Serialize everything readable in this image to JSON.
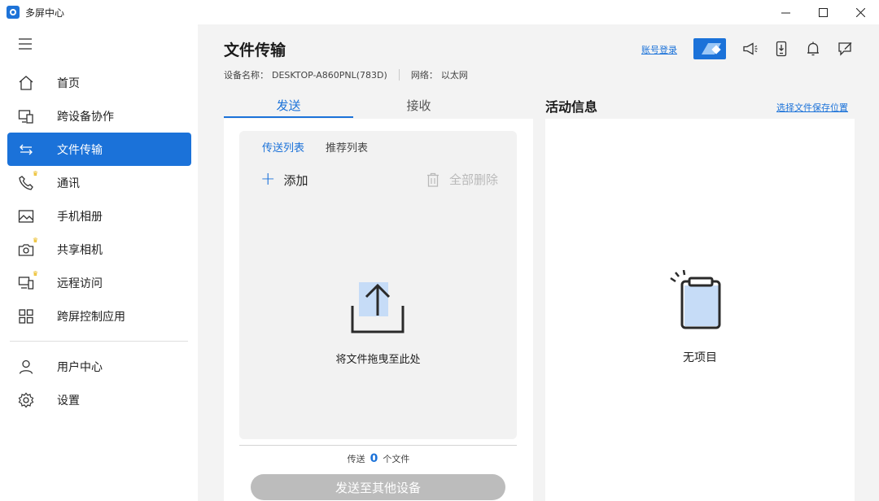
{
  "app": {
    "title": "多屏中心"
  },
  "sidebar": {
    "items": [
      {
        "label": "首页",
        "icon": "home-icon",
        "active": false
      },
      {
        "label": "跨设备协作",
        "icon": "devices-icon",
        "active": false
      },
      {
        "label": "文件传输",
        "icon": "transfer-icon",
        "active": true
      },
      {
        "label": "通讯",
        "icon": "phone-icon",
        "active": false,
        "premium": true
      },
      {
        "label": "手机相册",
        "icon": "gallery-icon",
        "active": false
      },
      {
        "label": "共享相机",
        "icon": "camera-icon",
        "active": false,
        "premium": true
      },
      {
        "label": "远程访问",
        "icon": "remote-icon",
        "active": false,
        "premium": true
      },
      {
        "label": "跨屏控制应用",
        "icon": "apps-grid-icon",
        "active": false
      }
    ],
    "bottom_items": [
      {
        "label": "用户中心",
        "icon": "user-icon"
      },
      {
        "label": "设置",
        "icon": "gear-icon"
      }
    ]
  },
  "header": {
    "title": "文件传输",
    "device_name_label": "设备名称：",
    "device_name": "DESKTOP-A860PNL(783D)",
    "network_label": "网络：",
    "network": "以太网",
    "login_link": "账号登录"
  },
  "tabs": {
    "send": "发送",
    "receive": "接收"
  },
  "send_panel": {
    "subtab_send_list": "传送列表",
    "subtab_recommend": "推荐列表",
    "add_label": "添加",
    "delete_all_label": "全部删除",
    "drop_hint": "将文件拖曳至此处",
    "count_prefix": "传送",
    "count": "0",
    "count_suffix": "个文件",
    "send_button": "发送至其他设备"
  },
  "activity": {
    "title": "活动信息",
    "save_location_link": "选择文件保存位置",
    "empty_text": "无项目"
  },
  "colors": {
    "accent": "#1b72d9",
    "sidebar_bg": "#ffffff",
    "page_bg": "#f3f3f3"
  }
}
